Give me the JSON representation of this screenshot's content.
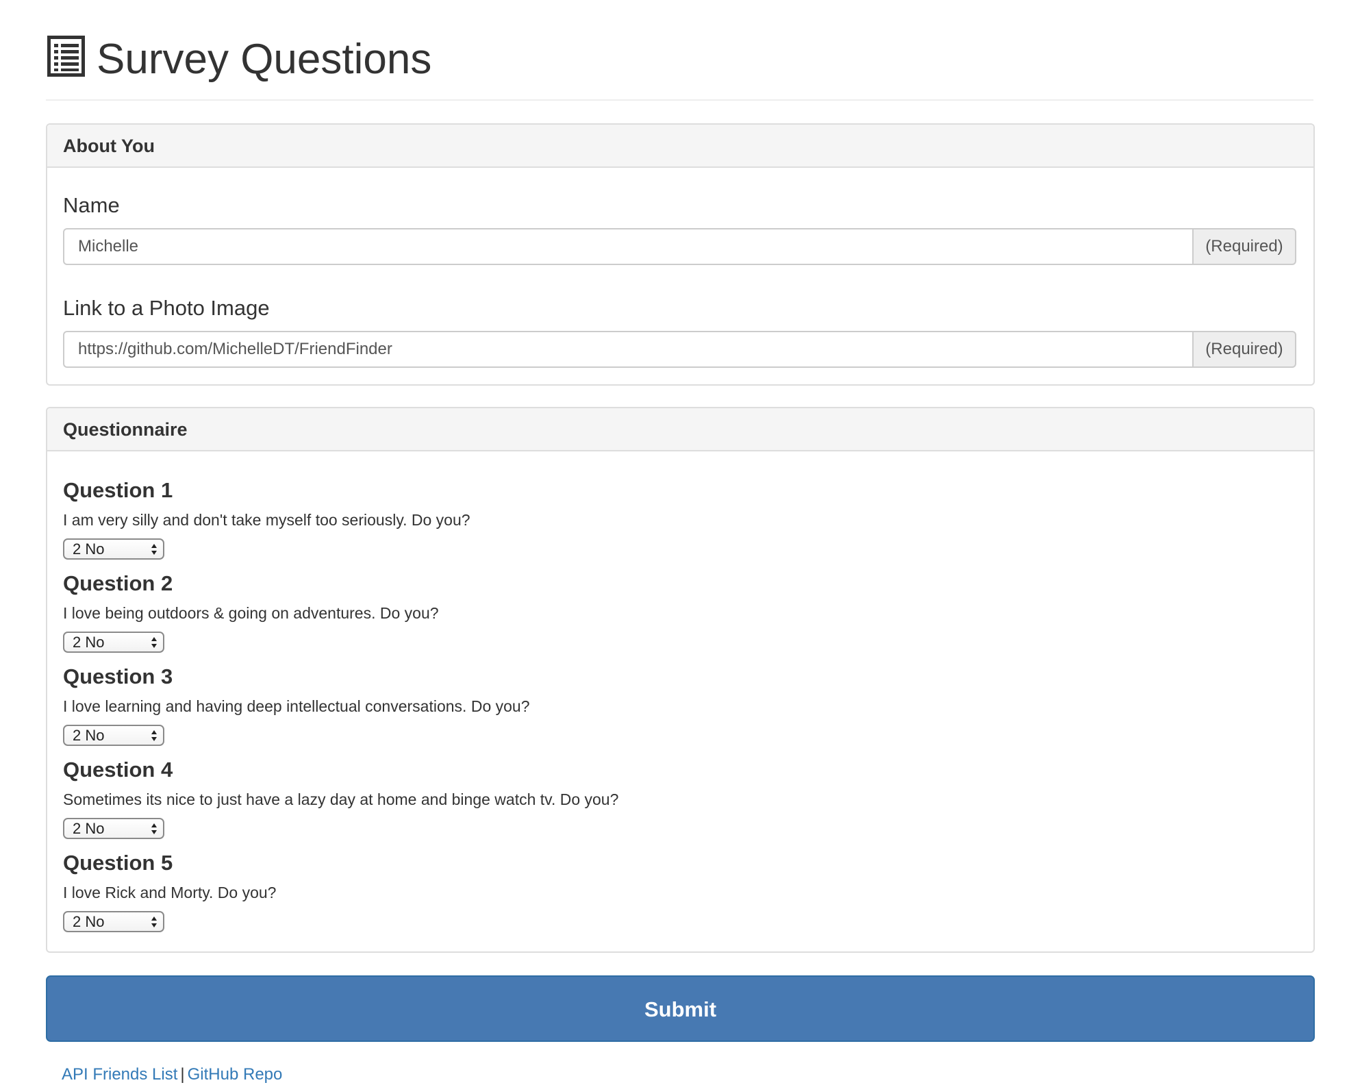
{
  "header": {
    "title": "Survey Questions",
    "icon": "list-alt-icon"
  },
  "about": {
    "heading": "About You",
    "name": {
      "label": "Name",
      "value": "Michelle",
      "addon": "(Required)"
    },
    "photo": {
      "label": "Link to a Photo Image",
      "value": "https://github.com/MichelleDT/FriendFinder",
      "addon": "(Required)"
    }
  },
  "questionnaire": {
    "heading": "Questionnaire",
    "questions": [
      {
        "title": "Question 1",
        "text": "I am very silly and don't take myself too seriously. Do you?",
        "selected": "2 No"
      },
      {
        "title": "Question 2",
        "text": "I love being outdoors & going on adventures. Do you?",
        "selected": "2 No"
      },
      {
        "title": "Question 3",
        "text": "I love learning and having deep intellectual conversations. Do you?",
        "selected": "2 No"
      },
      {
        "title": "Question 4",
        "text": "Sometimes its nice to just have a lazy day at home and binge watch tv. Do you?",
        "selected": "2 No"
      },
      {
        "title": "Question 5",
        "text": "I love Rick and Morty. Do you?",
        "selected": "2 No"
      }
    ]
  },
  "submit_label": "Submit",
  "footer": {
    "link1": "API Friends List",
    "separator": "|",
    "link2": "GitHub Repo"
  },
  "colors": {
    "primary": "#4779b2",
    "link": "#337ab7",
    "panel_heading_bg": "#f5f5f5",
    "border": "#dddddd"
  }
}
